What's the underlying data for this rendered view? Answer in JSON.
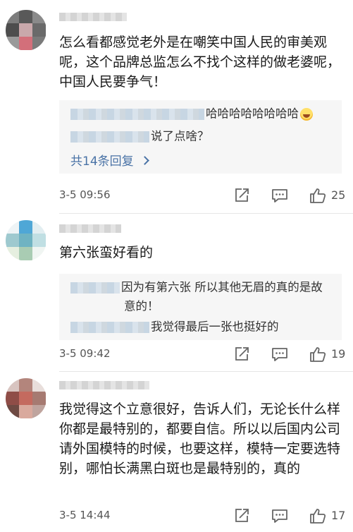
{
  "comments": [
    {
      "text": "怎么看都感觉老外是在嘲笑中国人民的审美观呢，这个品牌总监怎么不找个这样的做老婆呢，中国人民要争气！",
      "replies": [
        {
          "text": "哈哈哈哈哈哈哈哈",
          "emoji": "laughing-tears-emoji"
        },
        {
          "text": "说了点啥？"
        }
      ],
      "more_replies": "共14条回复",
      "time": "3-5 09:56",
      "likes": "25"
    },
    {
      "text": "第六张蛮好看的",
      "replies": [
        {
          "text": "因为有第六张 所以其他无眉的真的是故意的！"
        },
        {
          "text": "我觉得最后一张也挺好的"
        }
      ],
      "time": "3-5 09:42",
      "likes": "19"
    },
    {
      "text": "我觉得这个立意很好，告诉人们，无论长什么样你都是最特别的，都要自信。所以以后国内公司请外国模特的时候，也要这样，模特一定要选特别，哪怕长满黑白斑也是最特别的，真的",
      "replies": [],
      "time": "3-5 14:44",
      "likes": "17"
    }
  ],
  "icons": {
    "chevron": "chevron-right-icon",
    "share": "share-edit-icon",
    "comment": "comment-bubble-icon",
    "like": "thumbs-up-icon"
  },
  "colors": {
    "link": "#4a73a6",
    "reply_bg": "#f6f6f6",
    "meta": "#555555"
  }
}
